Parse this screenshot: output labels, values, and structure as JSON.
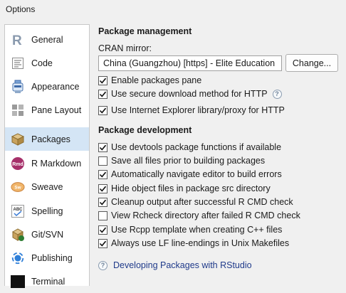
{
  "window": {
    "title": "Options"
  },
  "sidebar": {
    "items": [
      {
        "label": "General",
        "icon": "r-logo-icon"
      },
      {
        "label": "Code",
        "icon": "code-icon"
      },
      {
        "label": "Appearance",
        "icon": "appearance-icon"
      },
      {
        "label": "Pane Layout",
        "icon": "pane-layout-icon"
      },
      {
        "label": "Packages",
        "icon": "packages-icon",
        "selected": true
      },
      {
        "label": "R Markdown",
        "icon": "rmarkdown-icon"
      },
      {
        "label": "Sweave",
        "icon": "sweave-icon"
      },
      {
        "label": "Spelling",
        "icon": "spelling-icon"
      },
      {
        "label": "Git/SVN",
        "icon": "git-icon"
      },
      {
        "label": "Publishing",
        "icon": "publishing-icon"
      },
      {
        "label": "Terminal",
        "icon": "terminal-icon"
      }
    ]
  },
  "package_management": {
    "title": "Package management",
    "cran_label": "CRAN mirror:",
    "cran_value": "China (Guangzhou) [https] - Elite Education",
    "change_button": "Change...",
    "options": [
      {
        "label": "Enable packages pane",
        "checked": true
      },
      {
        "label": "Use secure download method for HTTP",
        "checked": true,
        "help": true
      },
      {
        "label": "Use Internet Explorer library/proxy for HTTP",
        "checked": true
      }
    ]
  },
  "package_development": {
    "title": "Package development",
    "options": [
      {
        "label": "Use devtools package functions if available",
        "checked": true
      },
      {
        "label": "Save all files prior to building packages",
        "checked": false
      },
      {
        "label": "Automatically navigate editor to build errors",
        "checked": true
      },
      {
        "label": "Hide object files in package src directory",
        "checked": true
      },
      {
        "label": "Cleanup output after successful R CMD check",
        "checked": true
      },
      {
        "label": "View Rcheck directory after failed R CMD check",
        "checked": false
      },
      {
        "label": "Use Rcpp template when creating C++ files",
        "checked": true
      },
      {
        "label": "Always use LF line-endings in Unix Makefiles",
        "checked": true
      }
    ]
  },
  "help_link": {
    "label": "Developing Packages with RStudio"
  },
  "colors": {
    "selection": "#d4e5f5",
    "link": "#1f3a8a"
  }
}
